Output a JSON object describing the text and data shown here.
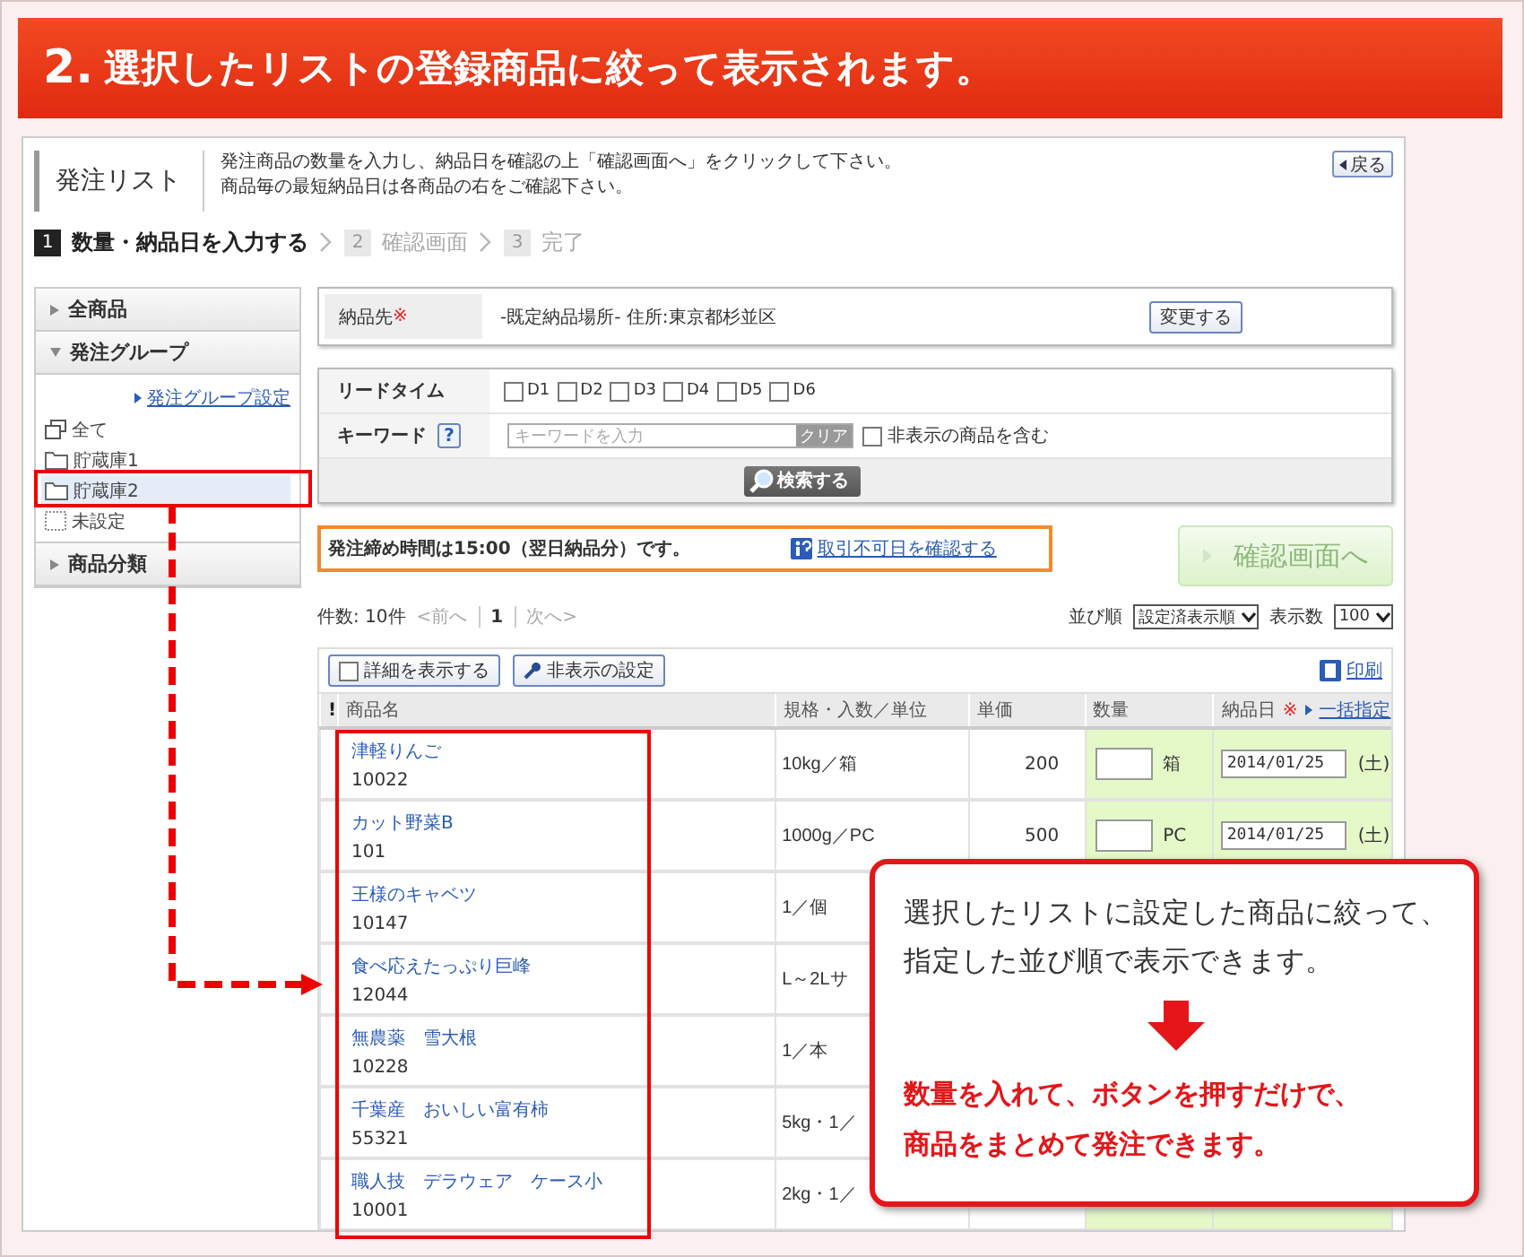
{
  "banner": {
    "number": "2.",
    "title": "選択したリストの登録商品に絞って表示されます。"
  },
  "page": {
    "title": "発注リスト",
    "description": [
      "発注商品の数量を入力し、納品日を確認の上「確認画面へ」をクリックして下さい。",
      "商品毎の最短納品日は各商品の右をご確認下さい。"
    ],
    "back_button": "戻る"
  },
  "steps": [
    {
      "number": "1",
      "label": "数量・納品日を入力する",
      "selected": true
    },
    {
      "number": "2",
      "label": "確認画面",
      "selected": false
    },
    {
      "number": "3",
      "label": "完了",
      "selected": false
    }
  ],
  "sidebar": {
    "sections": [
      {
        "label": "全商品",
        "expanded": false
      },
      {
        "label": "発注グループ",
        "expanded": true,
        "link": "発注グループ設定",
        "items": [
          {
            "label": "全て",
            "kind": "all",
            "selected": false
          },
          {
            "label": "貯蔵庫1",
            "kind": "folder",
            "selected": false
          },
          {
            "label": "貯蔵庫2",
            "kind": "folder",
            "selected": true
          },
          {
            "label": "未設定",
            "kind": "unset",
            "selected": false
          }
        ]
      },
      {
        "label": "商品分類",
        "expanded": false
      }
    ]
  },
  "delivery": {
    "label": "納品先",
    "required_mark": "※",
    "value": "-既定納品場所-  住所:東京都杉並区",
    "button": "変更する"
  },
  "search": {
    "lead_time": {
      "label": "リードタイム",
      "options": [
        {
          "label": "D1",
          "checked": false
        },
        {
          "label": "D2",
          "checked": false
        },
        {
          "label": "D3",
          "checked": false
        },
        {
          "label": "D4",
          "checked": false
        },
        {
          "label": "D5",
          "checked": false
        },
        {
          "label": "D6",
          "checked": false
        }
      ]
    },
    "keyword": {
      "label": "キーワード",
      "help": "?",
      "placeholder": "キーワードを入力",
      "clear_button": "クリア",
      "include_hidden": {
        "label": "非表示の商品を含む",
        "checked": false
      }
    },
    "button": "検索する"
  },
  "notice": {
    "text": "発注締め時間は15:00（翌日納品分）です。",
    "link": "取引不可日を確認する"
  },
  "confirm_button": {
    "label": "確認画面へ",
    "disabled": true
  },
  "pager": {
    "count": "件数: 10件",
    "prev": "<前へ",
    "page": "1",
    "next": "次へ>",
    "sort_label": "並び順",
    "sort_value": "設定済表示順",
    "per_page_label": "表示数",
    "per_page_value": "100"
  },
  "toolbar": {
    "detail": {
      "label": "詳細を表示する",
      "checked": false
    },
    "hidden_settings": "非表示の設定",
    "print": "印刷"
  },
  "table": {
    "columns": [
      "!",
      "商品名",
      "規格・入数／単位",
      "単価",
      "数量",
      "納品日"
    ],
    "required_mark": "※",
    "bulk_link": "一括指定",
    "rows": [
      {
        "name": "津軽りんご",
        "code": "10022",
        "spec": "10kg／箱",
        "price": "200",
        "unit": "箱",
        "date": "2014/01/25",
        "weekday": "(土)"
      },
      {
        "name": "カット野菜B",
        "code": "101",
        "spec": "1000g／PC",
        "price": "500",
        "unit": "PC",
        "date": "2014/01/25",
        "weekday": "(土)"
      },
      {
        "name": "王様のキャベツ",
        "code": "10147",
        "spec": "1／個"
      },
      {
        "name": "食べ応えたっぷり巨峰",
        "code": "12044",
        "spec": "L～2Lサ"
      },
      {
        "name": "無農薬　雪大根",
        "code": "10228",
        "spec": "1／本"
      },
      {
        "name": "千葉産　おいしい富有柿",
        "code": "55321",
        "spec": "5kg・1／"
      },
      {
        "name": "職人技　デラウェア　ケース小",
        "code": "10001",
        "spec": "2kg・1／"
      }
    ]
  },
  "callout": {
    "lines": [
      "選択したリストに設定した商品に絞って、",
      "指定した並び順で表示できます。"
    ],
    "emphasis": [
      "数量を入れて、ボタンを押すだけで、",
      "商品をまとめて発注できます。"
    ]
  }
}
